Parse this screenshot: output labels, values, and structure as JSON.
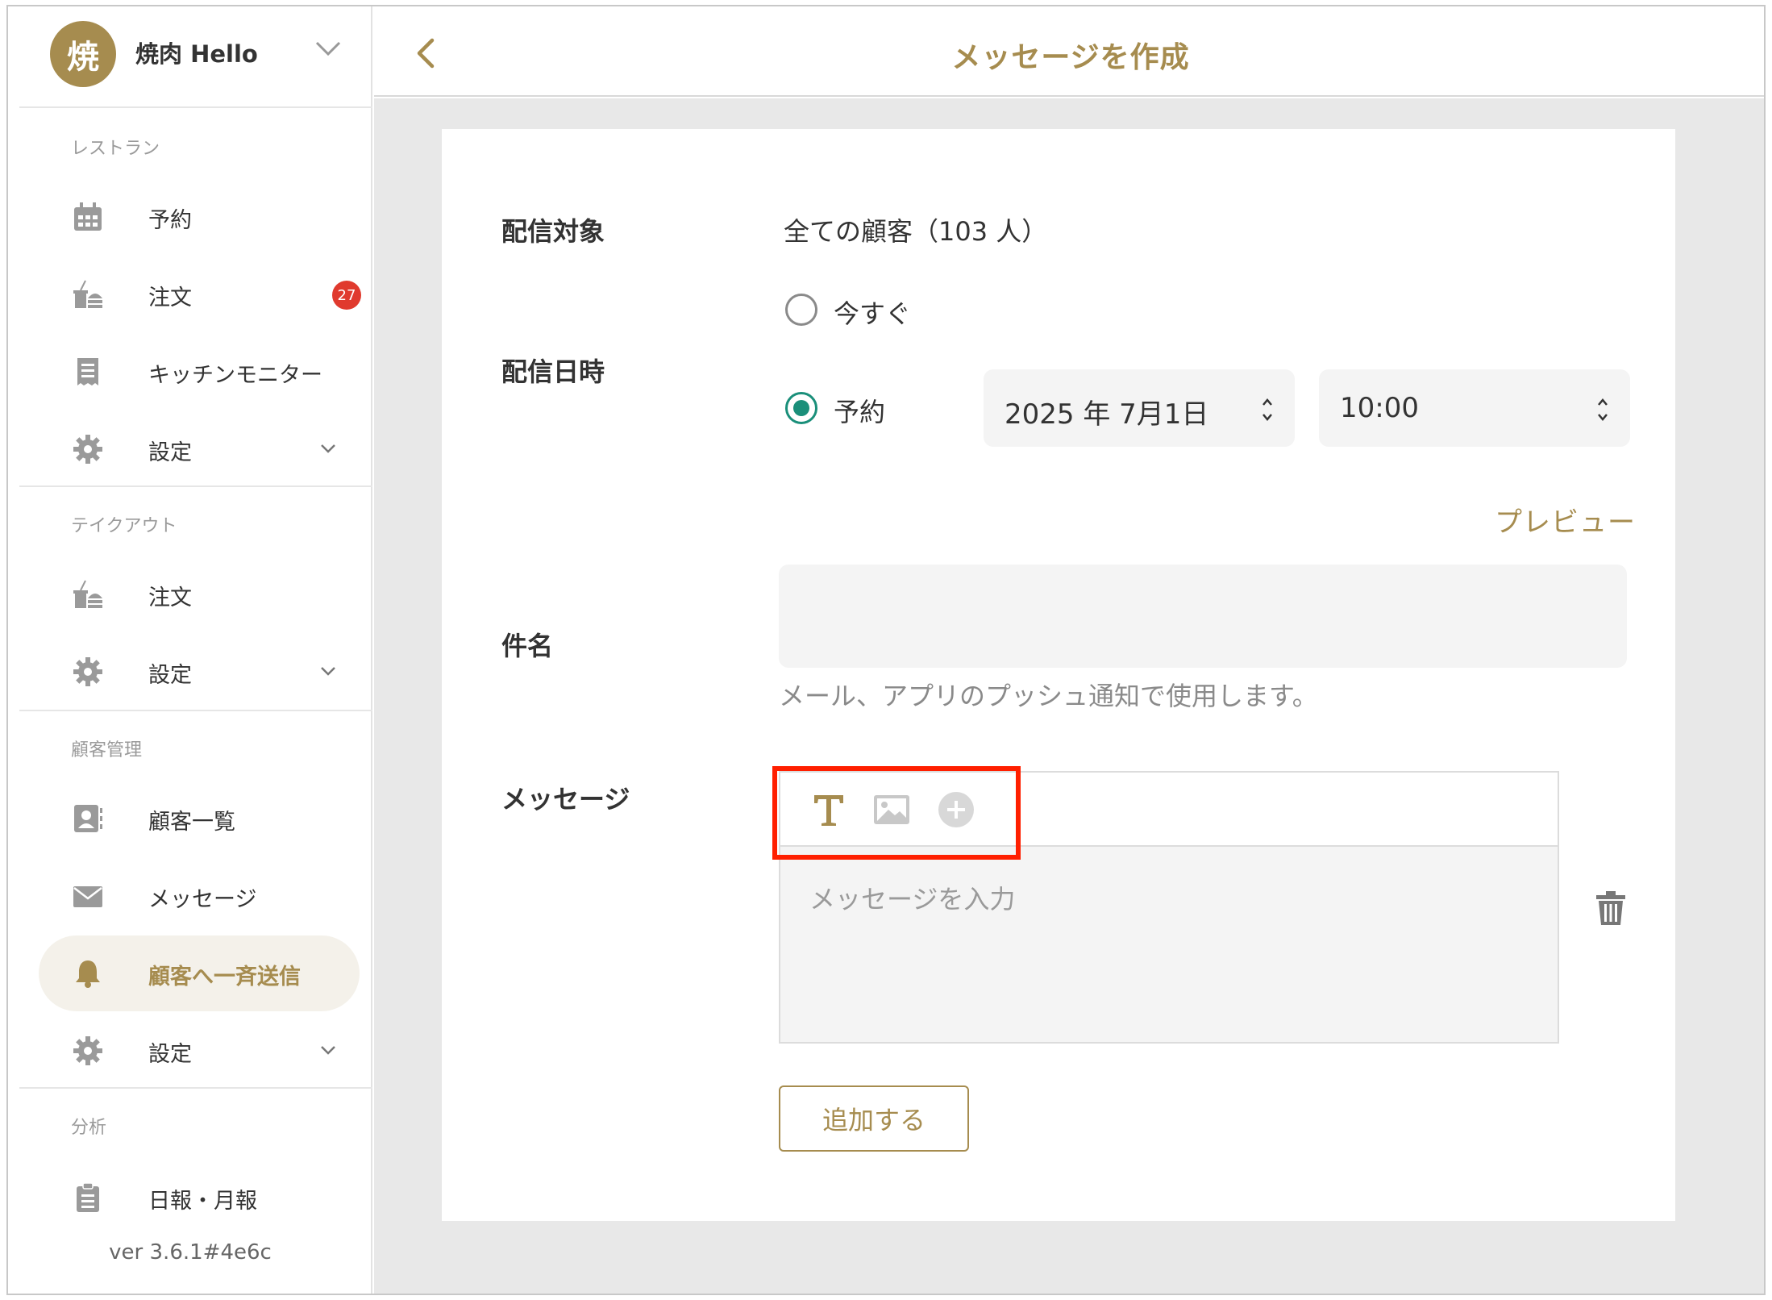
{
  "sidebar": {
    "avatar_char": "焼",
    "store_name": "焼肉 Hello",
    "sections": [
      {
        "title": "レストラン"
      },
      {
        "title": "テイクアウト"
      },
      {
        "title": "顧客管理"
      },
      {
        "title": "分析"
      }
    ],
    "items": [
      {
        "label": "予約",
        "icon": "calendar-icon"
      },
      {
        "label": "注文",
        "icon": "takeout-icon",
        "badge": "27"
      },
      {
        "label": "キッチンモニター",
        "icon": "receipt-icon"
      },
      {
        "label": "設定",
        "icon": "gear-icon"
      },
      {
        "label": "注文",
        "icon": "takeout-icon"
      },
      {
        "label": "設定",
        "icon": "gear-icon"
      },
      {
        "label": "顧客一覧",
        "icon": "contact-card-icon"
      },
      {
        "label": "メッセージ",
        "icon": "envelope-icon"
      },
      {
        "label": "顧客へ一斉送信",
        "icon": "bell-icon",
        "active": true
      },
      {
        "label": "設定",
        "icon": "gear-icon"
      },
      {
        "label": "日報・月報",
        "icon": "clipboard-icon"
      }
    ],
    "version": "ver 3.6.1#4e6c"
  },
  "header": {
    "title": "メッセージを作成"
  },
  "form": {
    "target_label": "配信対象",
    "target_value": "全ての顧客（103 人）",
    "schedule_label": "配信日時",
    "option_now": "今すぐ",
    "option_scheduled": "予約",
    "selected_option": "予約",
    "date_value": "2025 年 7月1日",
    "time_value": "10:00",
    "preview_label": "プレビュー",
    "subject_label": "件名",
    "subject_value": "",
    "subject_hint": "メール、アプリのプッシュ通知で使用します。",
    "message_label": "メッセージ",
    "message_placeholder": "メッセージを入力",
    "toolbar": [
      "text-format-icon",
      "image-icon",
      "add-circle-icon"
    ],
    "add_button": "追加する"
  },
  "colors": {
    "brand": "#a68c4f",
    "radio_selected": "#1a8f7a",
    "badge": "#e03a2e",
    "highlight": "#ff1f00"
  }
}
